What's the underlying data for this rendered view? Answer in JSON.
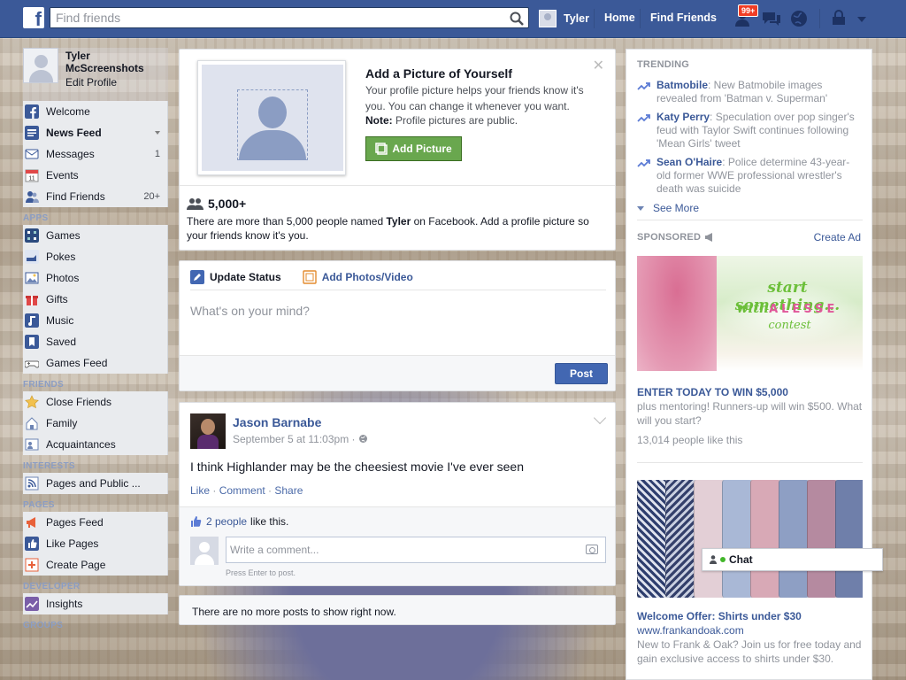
{
  "topbar": {
    "search_placeholder": "Find friends",
    "user_name": "Tyler",
    "home_label": "Home",
    "find_friends_label": "Find Friends",
    "notifications_badge": "99+",
    "brand_color": "#3b5998"
  },
  "profile": {
    "name": "Tyler McScreenshots",
    "edit_label": "Edit Profile"
  },
  "nav": {
    "favorites": [
      {
        "label": "Welcome",
        "icon": "facebook-icon"
      },
      {
        "label": "News Feed",
        "icon": "news-feed-icon"
      },
      {
        "label": "Messages",
        "icon": "messages-icon",
        "count": "1"
      },
      {
        "label": "Events",
        "icon": "calendar-icon",
        "count": ""
      },
      {
        "label": "Find Friends",
        "icon": "friends-icon",
        "count": "20+"
      }
    ],
    "apps_header": "APPS",
    "apps": [
      {
        "label": "Games",
        "icon": "games-icon"
      },
      {
        "label": "Pokes",
        "icon": "poke-icon"
      },
      {
        "label": "Photos",
        "icon": "photos-icon"
      },
      {
        "label": "Gifts",
        "icon": "gift-icon"
      },
      {
        "label": "Music",
        "icon": "music-icon"
      },
      {
        "label": "Saved",
        "icon": "bookmark-icon"
      },
      {
        "label": "Games Feed",
        "icon": "controller-icon"
      }
    ],
    "friends_header": "FRIENDS",
    "friends": [
      {
        "label": "Close Friends",
        "icon": "star-icon"
      },
      {
        "label": "Family",
        "icon": "family-icon"
      },
      {
        "label": "Acquaintances",
        "icon": "acquaintances-icon"
      }
    ],
    "interests_header": "INTERESTS",
    "interests": [
      {
        "label": "Pages and Public ...",
        "icon": "rss-icon"
      }
    ],
    "pages_header": "PAGES",
    "pages": [
      {
        "label": "Pages Feed",
        "icon": "megaphone-icon"
      },
      {
        "label": "Like Pages",
        "icon": "thumbs-up-icon"
      },
      {
        "label": "Create Page",
        "icon": "add-page-icon"
      }
    ],
    "developer_header": "DEVELOPER",
    "developer": [
      {
        "label": "Insights",
        "icon": "insights-icon"
      }
    ],
    "groups_header": "GROUPS"
  },
  "add_picture": {
    "title": "Add a Picture of Yourself",
    "text": "Your profile picture helps your friends know it's you. You can change it whenever you want.",
    "note_label": "Note:",
    "note_text": "Profile pictures are public.",
    "button_label": "Add Picture",
    "count": "5,000+",
    "desc_before": "There are more than 5,000 people named ",
    "desc_name": "Tyler",
    "desc_after": " on Facebook. Add a profile picture so your friends know it's you."
  },
  "composer": {
    "tab_status": "Update Status",
    "tab_photos": "Add Photos/Video",
    "placeholder": "What's on your mind?",
    "post_label": "Post"
  },
  "post": {
    "author": "Jason Barnabe",
    "timestamp": "September 5 at 11:03pm",
    "text": "I think Highlander may be the cheesiest movie I've ever seen",
    "like_label": "Like",
    "comment_label": "Comment",
    "share_label": "Share",
    "likes_count": "2 people",
    "likes_suffix": "like this.",
    "comment_placeholder": "Write a comment...",
    "comment_hint": "Press Enter to post."
  },
  "no_more_posts": "There are no more posts to show right now.",
  "trending": {
    "header": "TRENDING",
    "items": [
      {
        "topic": "Batmobile",
        "text": ": New Batmobile images revealed from 'Batman v. Superman'"
      },
      {
        "topic": "Katy Perry",
        "text": ": Speculation over pop singer's feud with Taylor Swift continues following 'Mean Girls' tweet"
      },
      {
        "topic": "Sean O'Haire",
        "text": ": Police determine 43-year-old former WWE professional wrestler's death was suicide"
      }
    ],
    "see_more": "See More"
  },
  "sponsored": {
    "header": "SPONSORED",
    "create_ad": "Create Ad",
    "ad1": {
      "image_line1": "start something...",
      "image_with": "with",
      "image_brand": "ALESSE",
      "image_line3": "contest",
      "title": "ENTER TODAY TO WIN $5,000",
      "text": "plus mentoring! Runners-up will win $500. What will you start?",
      "likes": "13,014 people like this"
    },
    "ad2": {
      "title": "Welcome Offer: Shirts under $30",
      "url": "www.frankandoak.com",
      "text": "New to Frank & Oak? Join us for free today and gain exclusive access to shirts under $30."
    }
  },
  "chat": {
    "label": "Chat"
  }
}
